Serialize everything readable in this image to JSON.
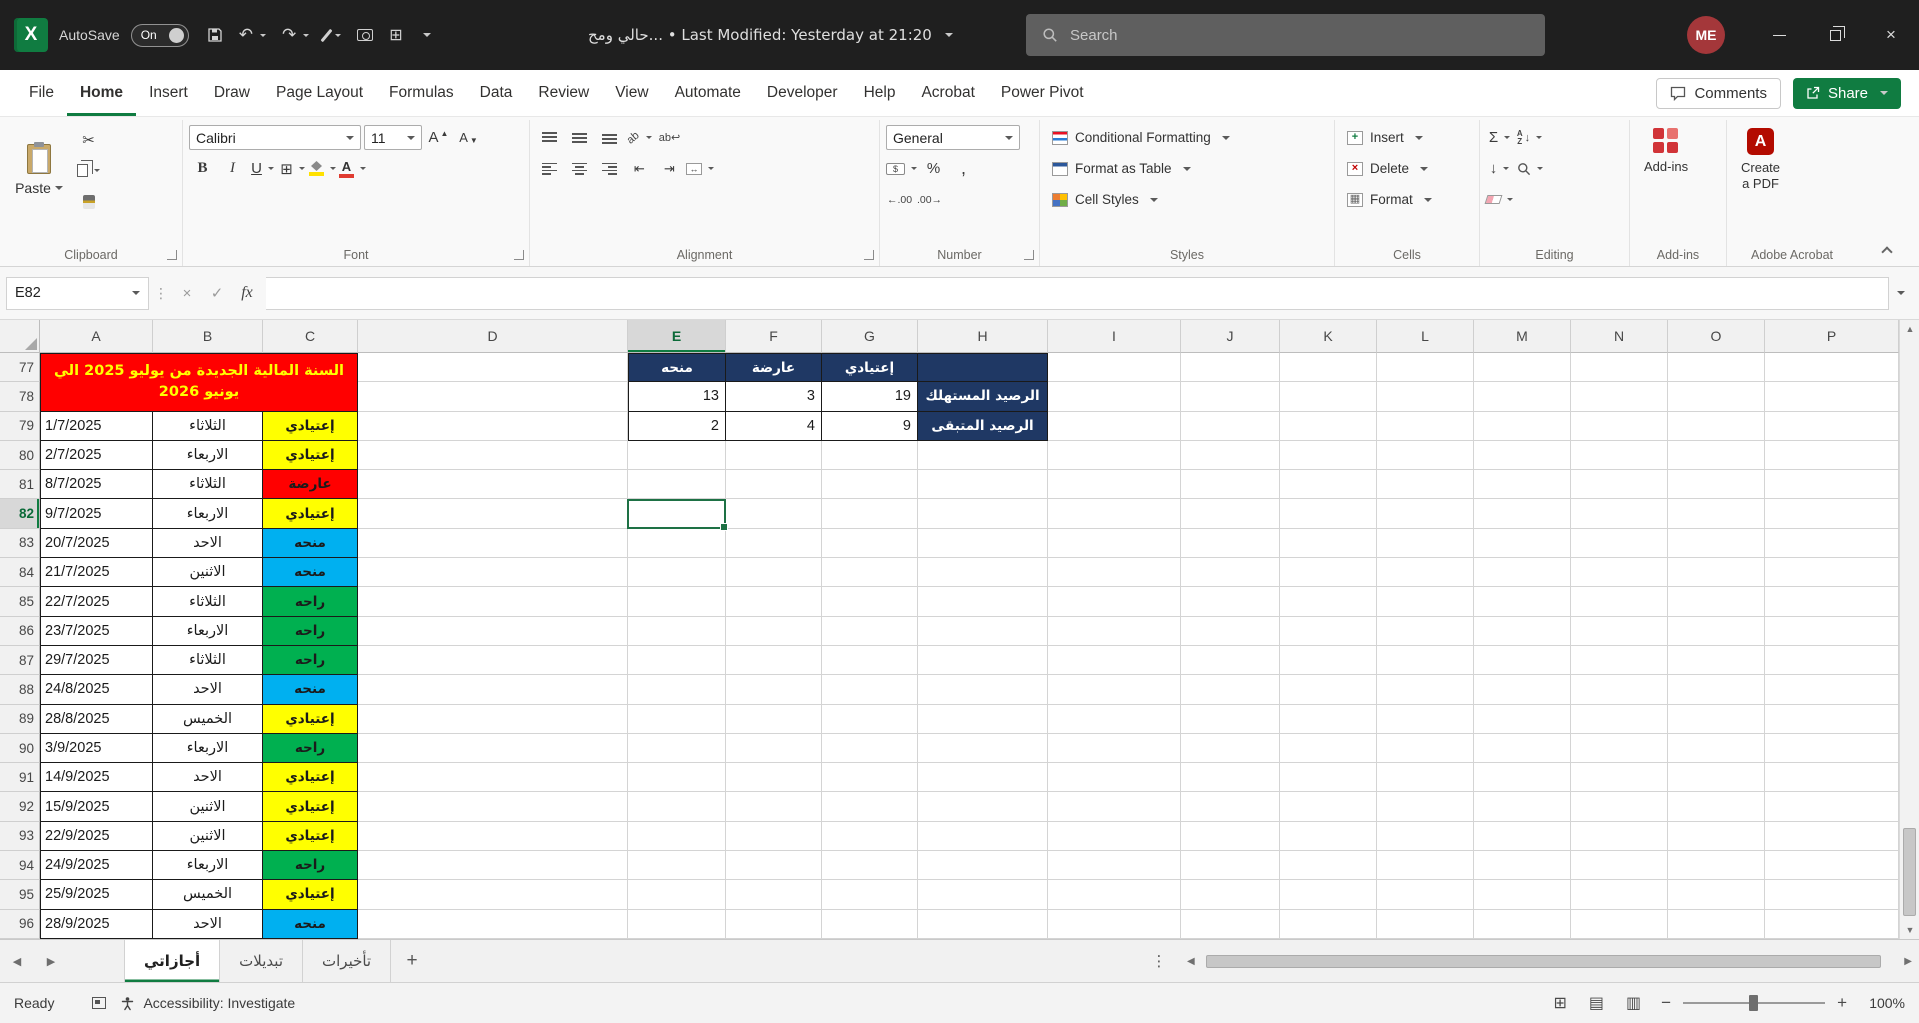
{
  "titlebar": {
    "autosave_label": "AutoSave",
    "autosave_state": "On",
    "doc_title": "حالي ومح... • Last Modified: Yesterday at 21:20",
    "search_placeholder": "Search",
    "avatar_initials": "ME"
  },
  "ribbon_tabs": [
    {
      "label": "File",
      "active": false
    },
    {
      "label": "Home",
      "active": true
    },
    {
      "label": "Insert",
      "active": false
    },
    {
      "label": "Draw",
      "active": false
    },
    {
      "label": "Page Layout",
      "active": false
    },
    {
      "label": "Formulas",
      "active": false
    },
    {
      "label": "Data",
      "active": false
    },
    {
      "label": "Review",
      "active": false
    },
    {
      "label": "View",
      "active": false
    },
    {
      "label": "Automate",
      "active": false
    },
    {
      "label": "Developer",
      "active": false
    },
    {
      "label": "Help",
      "active": false
    },
    {
      "label": "Acrobat",
      "active": false
    },
    {
      "label": "Power Pivot",
      "active": false
    }
  ],
  "top_actions": {
    "comments": "Comments",
    "share": "Share"
  },
  "ribbon": {
    "clipboard": {
      "paste": "Paste",
      "label": "Clipboard"
    },
    "font": {
      "family": "Calibri",
      "size": "11",
      "bold": "B",
      "italic": "I",
      "underline": "U",
      "label": "Font"
    },
    "alignment": {
      "orientation": "ab",
      "wrap": "ab↩",
      "label": "Alignment"
    },
    "number": {
      "format": "General",
      "percent": "%",
      "comma": ",",
      "inc_dec": "←.00",
      "dec_dec": ".00→",
      "label": "Number"
    },
    "styles": {
      "conditional": "Conditional Formatting",
      "format_table": "Format as Table",
      "cell_styles": "Cell Styles",
      "label": "Styles"
    },
    "cells": {
      "insert": "Insert",
      "delete": "Delete",
      "format": "Format",
      "label": "Cells"
    },
    "editing": {
      "autosum": "Σ",
      "label": "Editing"
    },
    "addins": {
      "button": "Add-ins",
      "label": "Add-ins"
    },
    "acrobat": {
      "line1": "Create",
      "line2": "a PDF",
      "label": "Adobe Acrobat"
    }
  },
  "formula_bar": {
    "name_box": "E82",
    "fx": "fx",
    "value": ""
  },
  "grid": {
    "selected_cell": "E82",
    "selected_column": "E",
    "selected_row": 82,
    "first_row": 77,
    "last_row": 96,
    "columns": [
      "A",
      "B",
      "C",
      "D",
      "E",
      "F",
      "G",
      "H",
      "I",
      "J",
      "K",
      "L",
      "M",
      "N",
      "O",
      "P"
    ],
    "banner": {
      "line1": "السنة المالية الجديدة من يوليو 2025 الي",
      "line2": "يونيو 2026"
    },
    "summary": {
      "col_headers": [
        "منحه",
        "عارضة",
        "إعتيادي"
      ],
      "rows": [
        {
          "label": "الرصيد المستهلك",
          "values": [
            13,
            3,
            19
          ]
        },
        {
          "label": "الرصيد المتبقى",
          "values": [
            2,
            4,
            9
          ]
        }
      ]
    },
    "type_colors": {
      "إعتيادي": "#FFFF00",
      "عارضة": "#FF0000",
      "منحه": "#00B0F0",
      "راحه": "#00B050"
    },
    "records": [
      {
        "row": 79,
        "date": "1/7/2025",
        "day": "الثلاثاء",
        "type": "إعتيادي"
      },
      {
        "row": 80,
        "date": "2/7/2025",
        "day": "الاربعاء",
        "type": "إعتيادي"
      },
      {
        "row": 81,
        "date": "8/7/2025",
        "day": "الثلاثاء",
        "type": "عارضة"
      },
      {
        "row": 82,
        "date": "9/7/2025",
        "day": "الاربعاء",
        "type": "إعتيادي"
      },
      {
        "row": 83,
        "date": "20/7/2025",
        "day": "الاحد",
        "type": "منحه"
      },
      {
        "row": 84,
        "date": "21/7/2025",
        "day": "الاثنين",
        "type": "منحه"
      },
      {
        "row": 85,
        "date": "22/7/2025",
        "day": "الثلاثاء",
        "type": "راحه"
      },
      {
        "row": 86,
        "date": "23/7/2025",
        "day": "الاربعاء",
        "type": "راحه"
      },
      {
        "row": 87,
        "date": "29/7/2025",
        "day": "الثلاثاء",
        "type": "راحه"
      },
      {
        "row": 88,
        "date": "24/8/2025",
        "day": "الاحد",
        "type": "منحه"
      },
      {
        "row": 89,
        "date": "28/8/2025",
        "day": "الخميس",
        "type": "إعتيادي"
      },
      {
        "row": 90,
        "date": "3/9/2025",
        "day": "الاربعاء",
        "type": "راحه"
      },
      {
        "row": 91,
        "date": "14/9/2025",
        "day": "الاحد",
        "type": "إعتيادي"
      },
      {
        "row": 92,
        "date": "15/9/2025",
        "day": "الاثنين",
        "type": "إعتيادي"
      },
      {
        "row": 93,
        "date": "22/9/2025",
        "day": "الاثنين",
        "type": "إعتيادي"
      },
      {
        "row": 94,
        "date": "24/9/2025",
        "day": "الاربعاء",
        "type": "راحه"
      },
      {
        "row": 95,
        "date": "25/9/2025",
        "day": "الخميس",
        "type": "إعتيادي"
      },
      {
        "row": 96,
        "date": "28/9/2025",
        "day": "الاحد",
        "type": "منحه"
      }
    ],
    "colors": {
      "banner_bg": "#FF0000",
      "banner_text": "#FFFF00",
      "summary_navy": "#1F3864",
      "accent_green": "#107C41"
    }
  },
  "sheet_tabs": {
    "tabs": [
      {
        "label": "أجازاتي",
        "active": true
      },
      {
        "label": "تبديلات",
        "active": false
      },
      {
        "label": "تأخيرات",
        "active": false
      }
    ]
  },
  "status_bar": {
    "ready": "Ready",
    "accessibility": "Accessibility: Investigate",
    "zoom": "100%"
  }
}
